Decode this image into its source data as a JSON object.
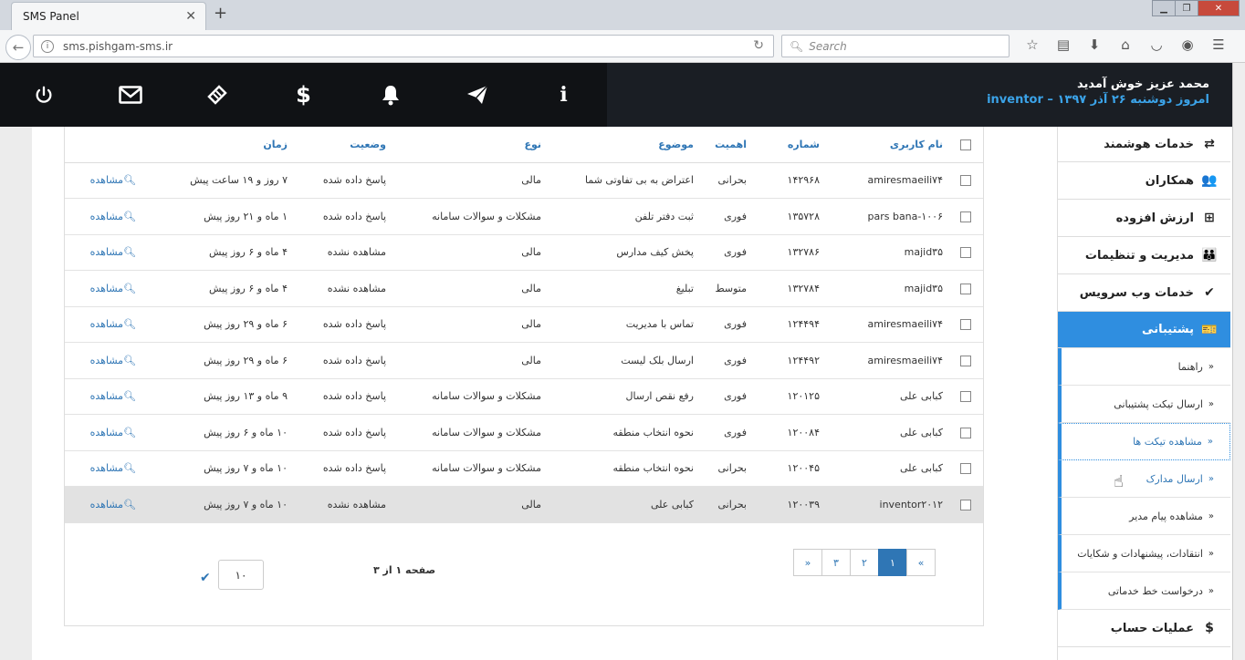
{
  "browser": {
    "tab_title": "SMS Panel",
    "url": "sms.pishgam-sms.ir",
    "search_placeholder": "Search"
  },
  "header": {
    "welcome": "محمد عزیز خوش آمدید",
    "user_line": "inventor – امروز دوشنبه ۲۶ آذر ۱۳۹۷"
  },
  "table": {
    "headers": [
      "نام کاربری",
      "شماره",
      "اهمیت",
      "موضوع",
      "نوع",
      "وضعیت",
      "زمان"
    ],
    "view_label": "مشاهده",
    "rows": [
      [
        "amiresmaeili۷۴",
        "۱۴۲۹۶۸",
        "بحرانی",
        "اعتراض به بی تفاوتی شما",
        "مالی",
        "پاسخ داده شده",
        "۷ روز و ۱۹ ساعت پیش"
      ],
      [
        "pars bana-۱۰۰۶",
        "۱۳۵۷۲۸",
        "فوری",
        "ثبت دفتر تلفن",
        "مشکلات و سوالات سامانه",
        "پاسخ داده شده",
        "۱ ماه و ۲۱ روز پیش"
      ],
      [
        "majid۳۵",
        "۱۳۲۷۸۶",
        "فوری",
        "پخش کیف مدارس",
        "مالی",
        "مشاهده نشده",
        "۴ ماه و ۶ روز پیش"
      ],
      [
        "majid۳۵",
        "۱۳۲۷۸۴",
        "متوسط",
        "تبلیغ",
        "مالی",
        "مشاهده نشده",
        "۴ ماه و ۶ روز پیش"
      ],
      [
        "amiresmaeili۷۴",
        "۱۲۴۴۹۴",
        "فوری",
        "تماس با مدیریت",
        "مالی",
        "پاسخ داده شده",
        "۶ ماه و ۲۹ روز پیش"
      ],
      [
        "amiresmaeili۷۴",
        "۱۲۴۴۹۲",
        "فوری",
        "ارسال بلک لیست",
        "مالی",
        "پاسخ داده شده",
        "۶ ماه و ۲۹ روز پیش"
      ],
      [
        "کبابی علی",
        "۱۲۰۱۲۵",
        "فوری",
        "رفع نقص ارسال",
        "مشکلات و سوالات سامانه",
        "پاسخ داده شده",
        "۹ ماه و ۱۳ روز پیش"
      ],
      [
        "کبابی علی",
        "۱۲۰۰۸۴",
        "فوری",
        "نحوه انتخاب منطقه",
        "مشکلات و سوالات سامانه",
        "پاسخ داده شده",
        "۱۰ ماه و ۶ روز پیش"
      ],
      [
        "کبابی علی",
        "۱۲۰۰۴۵",
        "بحرانی",
        "نحوه انتخاب منطقه",
        "مشکلات و سوالات سامانه",
        "پاسخ داده شده",
        "۱۰ ماه و ۷ روز پیش"
      ],
      [
        "inventor۲۰۱۲",
        "۱۲۰۰۳۹",
        "بحرانی",
        "کبابی علی",
        "مالی",
        "مشاهده نشده",
        "۱۰ ماه و ۷ روز پیش"
      ]
    ]
  },
  "pager": {
    "prev": "«",
    "pages": [
      "۱",
      "۲",
      "۳"
    ],
    "next": "»",
    "info": "صفحه ۱ از ۳",
    "per_page": "۱۰"
  },
  "sidebar": {
    "items": [
      {
        "label": "خدمات هوشمند",
        "icon": "⇄"
      },
      {
        "label": "همکاران",
        "icon": "👥"
      },
      {
        "label": "ارزش افزوده",
        "icon": "⊞"
      },
      {
        "label": "مدیریت و تنظیمات",
        "icon": "👪"
      },
      {
        "label": "خدمات وب سرویس",
        "icon": "✔"
      }
    ],
    "active": {
      "label": "پشتیبانی",
      "icon": "🎫"
    },
    "subitems": [
      "راهنما",
      "ارسال تیکت پشتیبانی",
      "مشاهده تیکت ها",
      "ارسال مدارک",
      "مشاهده پیام مدیر",
      "انتقادات، پیشنهادات و شکایات",
      "درخواست خط خدماتی"
    ],
    "bottom": {
      "label": "عملیات حساب",
      "icon": "$"
    }
  }
}
